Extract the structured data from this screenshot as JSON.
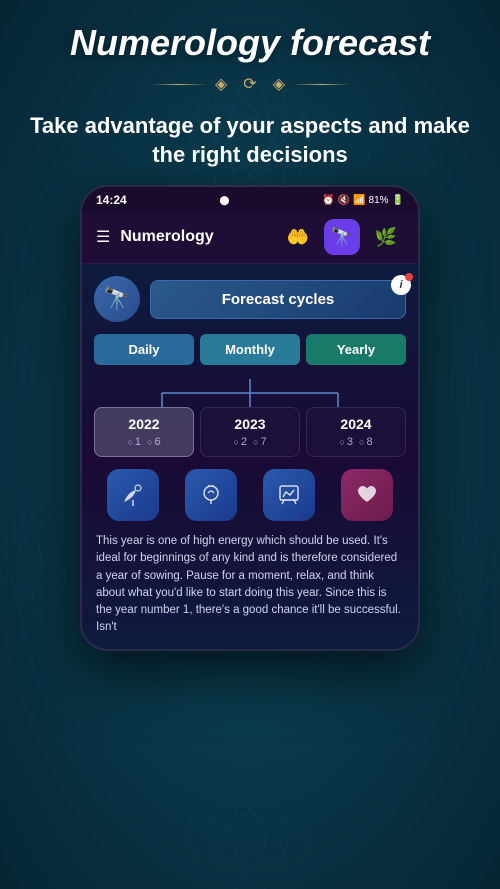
{
  "page": {
    "title": "Numerology forecast",
    "subtitle": "Take advantage of your aspects and make the right decisions",
    "bg_color": "#0a3a4a",
    "accent_color": "#c8a96e"
  },
  "divider": {
    "symbol": "⟳"
  },
  "phone": {
    "status_bar": {
      "time": "14:24",
      "icons": "🔔 🔇 📶 81%"
    },
    "nav": {
      "title": "Numerology",
      "menu_icon": "☰"
    },
    "nav_icons": [
      {
        "label": "🤲",
        "active": false
      },
      {
        "label": "🔭",
        "active": true
      },
      {
        "label": "🌿",
        "active": false
      }
    ],
    "forecast_section": {
      "telescope_icon": "🔭",
      "forecast_cycles_label": "Forecast cycles",
      "info_label": "i"
    },
    "tabs": [
      {
        "id": "daily",
        "label": "Daily"
      },
      {
        "id": "monthly",
        "label": "Monthly"
      },
      {
        "id": "yearly",
        "label": "Yearly"
      }
    ],
    "years": [
      {
        "year": "2022",
        "num1": "1",
        "num2": "6",
        "selected": true
      },
      {
        "year": "2023",
        "num1": "2",
        "num2": "7",
        "selected": false
      },
      {
        "year": "2024",
        "num1": "3",
        "num2": "8",
        "selected": false
      }
    ],
    "action_icons": [
      {
        "icon": "🌱",
        "type": "normal"
      },
      {
        "icon": "💡",
        "type": "normal"
      },
      {
        "icon": "📊",
        "type": "normal"
      },
      {
        "icon": "❤️",
        "type": "heart"
      }
    ],
    "description": "This year is one of high energy which should be used. It's ideal for beginnings of any kind and is therefore considered a year of sowing. Pause for a moment, relax, and think about what you'd like to start doing this year. Since this is the year number 1, there's a good chance it'll be successful. Isn't"
  }
}
